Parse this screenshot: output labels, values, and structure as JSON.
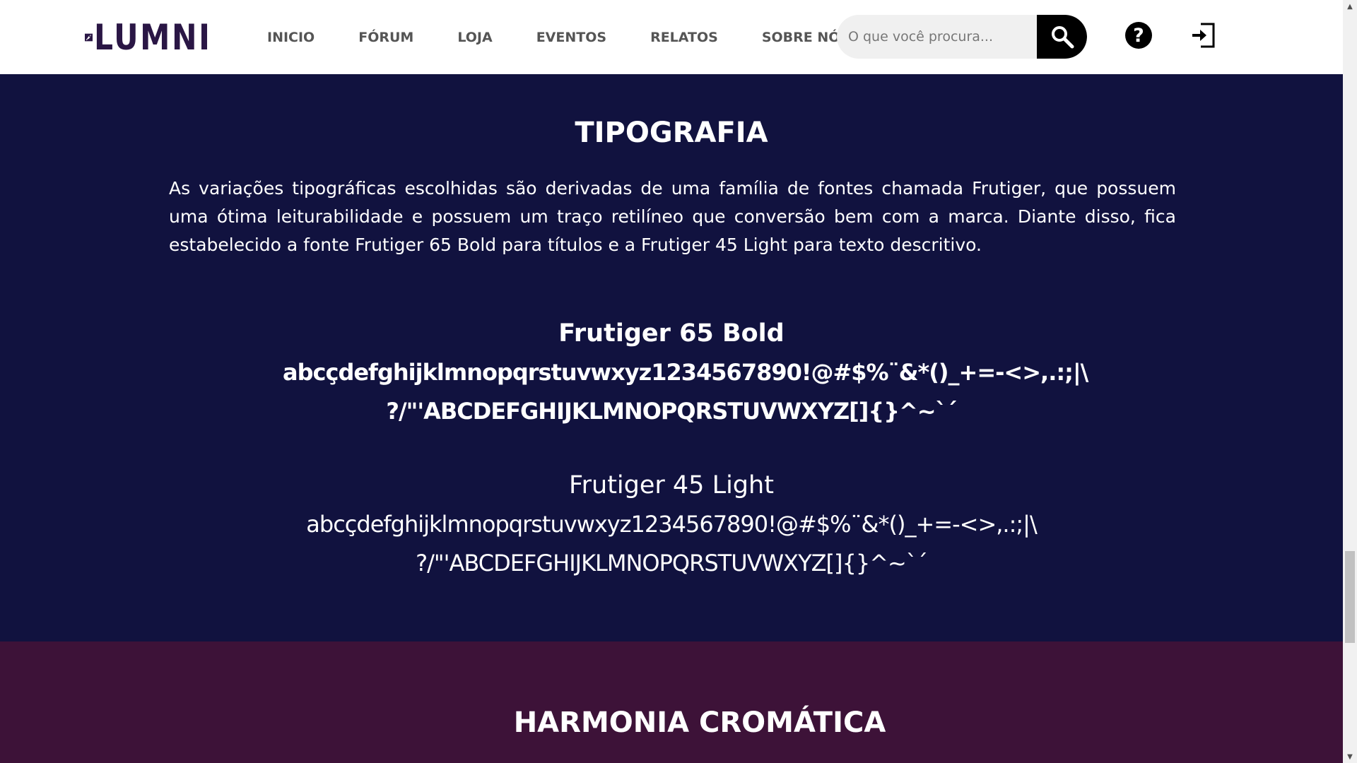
{
  "header": {
    "logo_text": "LUMNI",
    "nav": [
      "INICIO",
      "FÓRUM",
      "LOJA",
      "EVENTOS",
      "RELATOS",
      "SOBRE NÓS"
    ],
    "search": {
      "placeholder": "O que você procura..."
    },
    "help_label": "?",
    "icons": {
      "search": "search-icon",
      "help": "help-icon",
      "login": "login-icon"
    }
  },
  "tipografia": {
    "title": "TIPOGRAFIA",
    "description": "As variações tipográficas escolhidas são derivadas de uma família de fontes chamada Frutiger, que possuem uma ótima leiturabilidade e possuem um traço retilíneo que conversão bem com a marca. Diante disso, fica estabelecido a fonte Frutiger 65 Bold para títulos e a Frutiger 45 Light para texto descritivo.",
    "samples": [
      {
        "name": "Frutiger 65 Bold",
        "line1": "abcçdefghijklmnopqrstuvwxyz1234567890!@#$%¨&*()_+=-<>,.:;|\\",
        "line2": "?/\"'ABCDEFGHIJKLMNOPQRSTUVWXYZ[]{}^~`´"
      },
      {
        "name": "Frutiger 45 Light",
        "line1": "abcçdefghijklmnopqrstuvwxyz1234567890!@#$%¨&*()_+=-<>,.:;|\\",
        "line2": "?/\"'ABCDEFGHIJKLMNOPQRSTUVWXYZ[]{}^~`´"
      }
    ]
  },
  "harmonia": {
    "title": "HARMONIA CROMÁTICA"
  },
  "colors": {
    "header_bg": "#ffffff",
    "tipografia_bg": "#11123f",
    "harmonia_bg": "#3d1238",
    "logo": "#2a1645",
    "nav_text": "#555555"
  }
}
